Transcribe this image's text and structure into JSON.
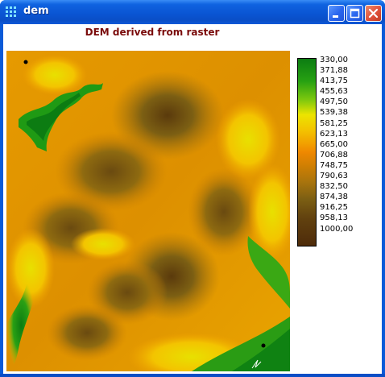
{
  "window": {
    "title": "dem",
    "icon": "grid-app-icon",
    "buttons": {
      "minimize": "minimize-icon",
      "maximize": "maximize-icon",
      "close": "close-icon"
    }
  },
  "map": {
    "title": "DEM derived from raster",
    "title_color": "#7a0b0b"
  },
  "legend": {
    "labels": [
      "330,00",
      "371,88",
      "413,75",
      "455,63",
      "497,50",
      "539,38",
      "581,25",
      "623,13",
      "665,00",
      "706,88",
      "748,75",
      "790,63",
      "832,50",
      "874,38",
      "916,25",
      "958,13",
      "1000,00"
    ],
    "colors": {
      "low": "#0c7c12",
      "mid": "#ef8800",
      "high": "#4e2b0a"
    }
  }
}
